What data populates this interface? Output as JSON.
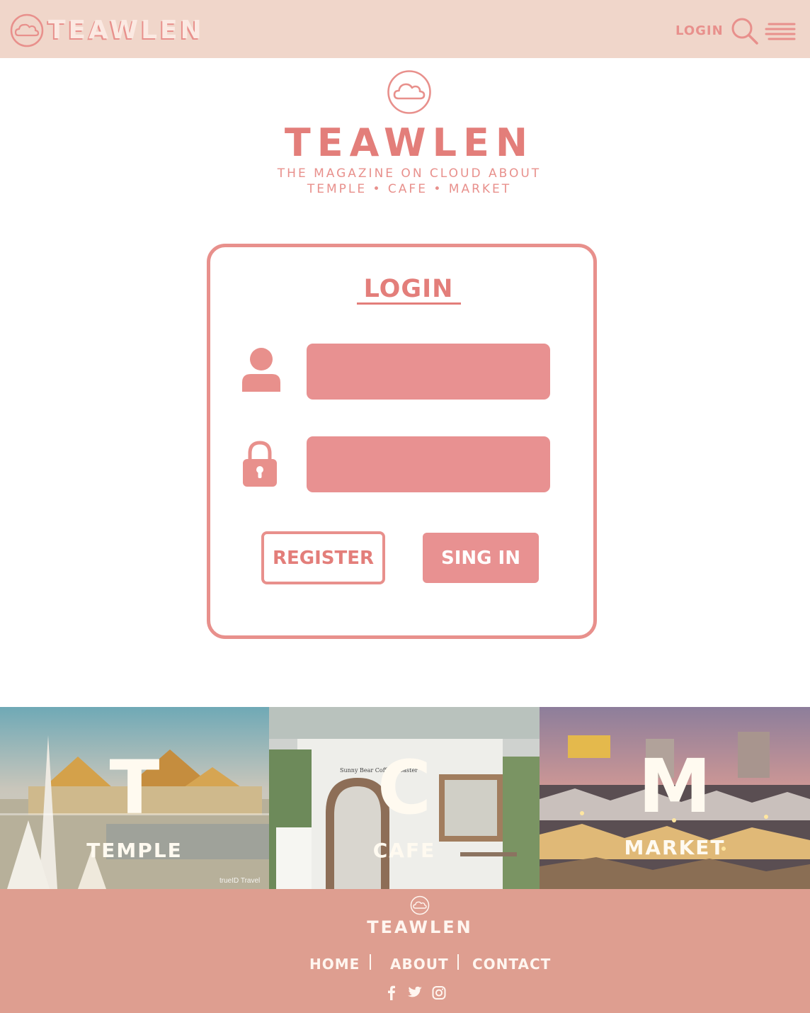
{
  "header": {
    "brand": "TEAWLEN",
    "login_link": "LOGIN",
    "icons": [
      "cloud-logo-icon",
      "search-icon",
      "menu-icon"
    ]
  },
  "hero": {
    "title": "TEAWLEN",
    "subtitle_line1": "THE MAGAZINE ON CLOUD ABOUT",
    "subtitle_line2": "TEMPLE • CAFE • MARKET"
  },
  "login": {
    "title": "LOGIN",
    "username": {
      "value": "",
      "placeholder": "",
      "icon": "user-icon"
    },
    "password": {
      "value": "",
      "placeholder": "",
      "icon": "lock-icon"
    },
    "register_label": "REGISTER",
    "signin_label": "SING IN"
  },
  "categories": [
    {
      "letter": "T",
      "label": "TEMPLE"
    },
    {
      "letter": "C",
      "label": "CAFE"
    },
    {
      "letter": "M",
      "label": "MARKET"
    }
  ],
  "footer": {
    "brand": "TEAWLEN",
    "nav": [
      "HOME",
      "ABOUT",
      "CONTACT"
    ],
    "social": [
      "facebook-icon",
      "twitter-icon",
      "instagram-icon"
    ]
  },
  "colors": {
    "header_bg": "#f0d6ca",
    "accent": "#e8908c",
    "accent_dark": "#e37e7a",
    "footer_bg": "#de9e90",
    "tile_text": "#fffaf0"
  }
}
